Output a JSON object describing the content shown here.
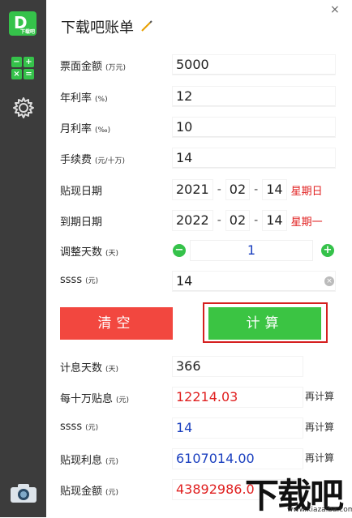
{
  "app": {
    "title": "下载吧账单",
    "logo_text": "D",
    "logo_small": "下载吧"
  },
  "sidebar": {
    "calc_symbols": [
      "−",
      "+",
      "×",
      "="
    ]
  },
  "form": {
    "face_amount": {
      "label": "票面金额",
      "unit": "(万元)",
      "value": "5000"
    },
    "annual_rate": {
      "label": "年利率",
      "unit": "(%)",
      "value": "12"
    },
    "monthly_rate": {
      "label": "月利率",
      "unit": "(‰)",
      "value": "10"
    },
    "fee": {
      "label": "手续费",
      "unit": "(元/十万)",
      "value": "14"
    },
    "discount_date": {
      "label": "贴现日期",
      "year": "2021",
      "month": "02",
      "day": "14",
      "weekday": "星期日",
      "sep": "-"
    },
    "due_date": {
      "label": "到期日期",
      "year": "2022",
      "month": "02",
      "day": "14",
      "weekday": "星期一",
      "sep": "-"
    },
    "adjust_days": {
      "label": "调整天数",
      "unit": "(天)",
      "value": "1",
      "minus": "−",
      "plus": "+"
    },
    "ssss": {
      "label": "ssss",
      "unit": "(元)",
      "value": "14",
      "clear": "×"
    }
  },
  "buttons": {
    "clear": "清空",
    "calculate": "计算"
  },
  "results": {
    "interest_days": {
      "label": "计息天数",
      "unit": "(天)",
      "value": "366"
    },
    "per_100k": {
      "label": "每十万贴息",
      "unit": "(元)",
      "value": "12214.03",
      "recalc": "再计算"
    },
    "ssss": {
      "label": "ssss",
      "unit": "(元)",
      "value": "14",
      "recalc": "再计算"
    },
    "discount_interest": {
      "label": "贴现利息",
      "unit": "(元)",
      "value": "6107014.00",
      "recalc": "再计算"
    },
    "discount_amount": {
      "label": "贴现金额",
      "unit": "(元)",
      "value": "43892986.0"
    }
  },
  "window": {
    "close": "×"
  },
  "watermark": {
    "text": "下载吧",
    "url": "www.xiazaiba.com"
  },
  "colors": {
    "sidebar": "#3c3c3c",
    "green": "#35c24a",
    "red_button": "#f2473f",
    "calc_button": "#3bc443",
    "highlight": "#d51f1f"
  }
}
